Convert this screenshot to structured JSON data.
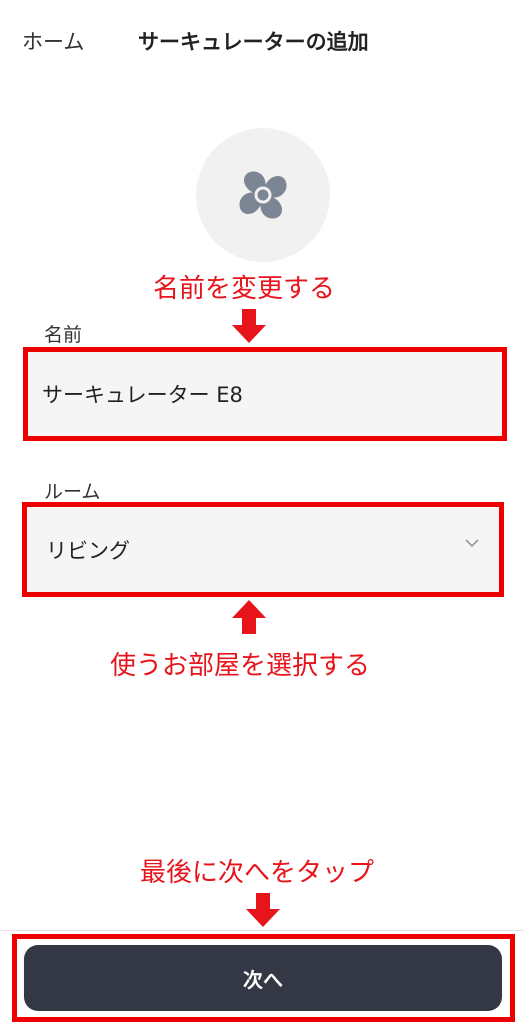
{
  "nav": {
    "back_label": "ホーム",
    "title": "サーキュレーターの追加"
  },
  "device": {
    "icon": "fan-icon"
  },
  "annotations": {
    "rename": "名前を変更する",
    "room": "使うお部屋を選択する",
    "next": "最後に次へをタップ",
    "color": "#e8141b"
  },
  "form": {
    "name_label": "名前",
    "name_value": "サーキュレーター E8",
    "room_label": "ルーム",
    "room_value": "リビング"
  },
  "footer": {
    "next_label": "次へ"
  }
}
